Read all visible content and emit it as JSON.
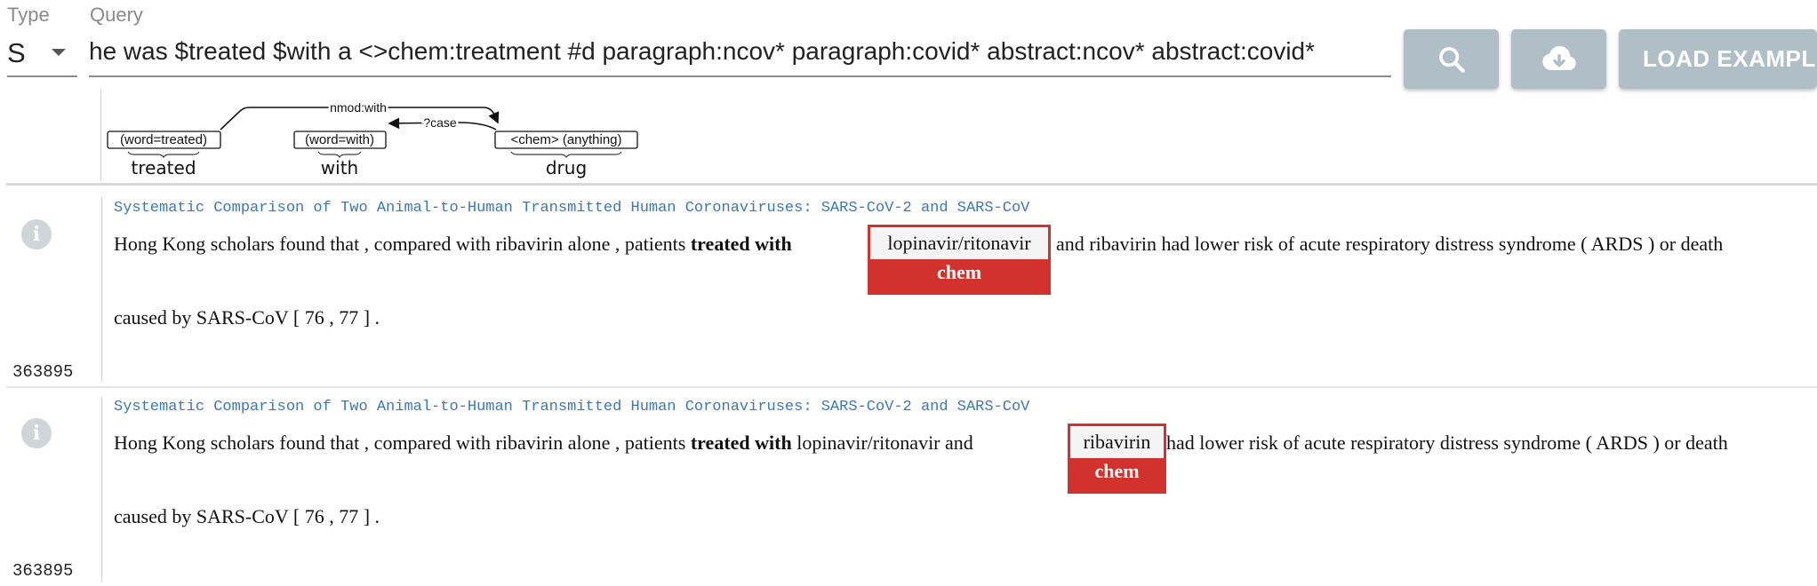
{
  "header": {
    "type_label": "Type",
    "query_label": "Query",
    "type_value": "S",
    "query_value": "he was $treated $with a <>chem:treatment #d paragraph:ncov* paragraph:covid* abstract:ncov* abstract:covid*",
    "search_icon": "search-icon",
    "download_icon": "cloud-download-icon",
    "load_examples_label": "LOAD EXAMPLE"
  },
  "graph": {
    "nodes": [
      {
        "constraint": "(word=treated)",
        "word": "treated"
      },
      {
        "constraint": "(word=with)",
        "word": "with"
      },
      {
        "constraint": "<chem> (anything)",
        "word": "drug"
      }
    ],
    "edges": [
      {
        "label": "nmod:with",
        "from": "treated",
        "to": "drug"
      },
      {
        "label": "?case",
        "from": "drug",
        "to": "with"
      }
    ]
  },
  "results": [
    {
      "title": "Systematic Comparison of Two Animal-to-Human Transmitted Human Coronaviruses: SARS-CoV-2 and SARS-CoV",
      "pre": "Hong Kong scholars found that , compared with ribavirin alone , patients ",
      "bold": "treated with",
      "mid": "",
      "entity_text": "lopinavir/ritonavir",
      "entity_label": "chem",
      "post": " and ribavirin had lower risk of acute respiratory distress syndrome ( ARDS ) or death",
      "line2": "caused by SARS-CoV [ 76 , 77 ] .",
      "id": "363895"
    },
    {
      "title": "Systematic Comparison of Two Animal-to-Human Transmitted Human Coronaviruses: SARS-CoV-2 and SARS-CoV",
      "pre": "Hong Kong scholars found that , compared with ribavirin alone , patients ",
      "bold": "treated with",
      "mid": " lopinavir/ritonavir and",
      "entity_text": "ribavirin",
      "entity_label": "chem",
      "post": " had lower risk of acute respiratory distress syndrome ( ARDS ) or death",
      "line2": "caused by SARS-CoV [ 76 , 77 ] .",
      "id": "363895"
    }
  ]
}
